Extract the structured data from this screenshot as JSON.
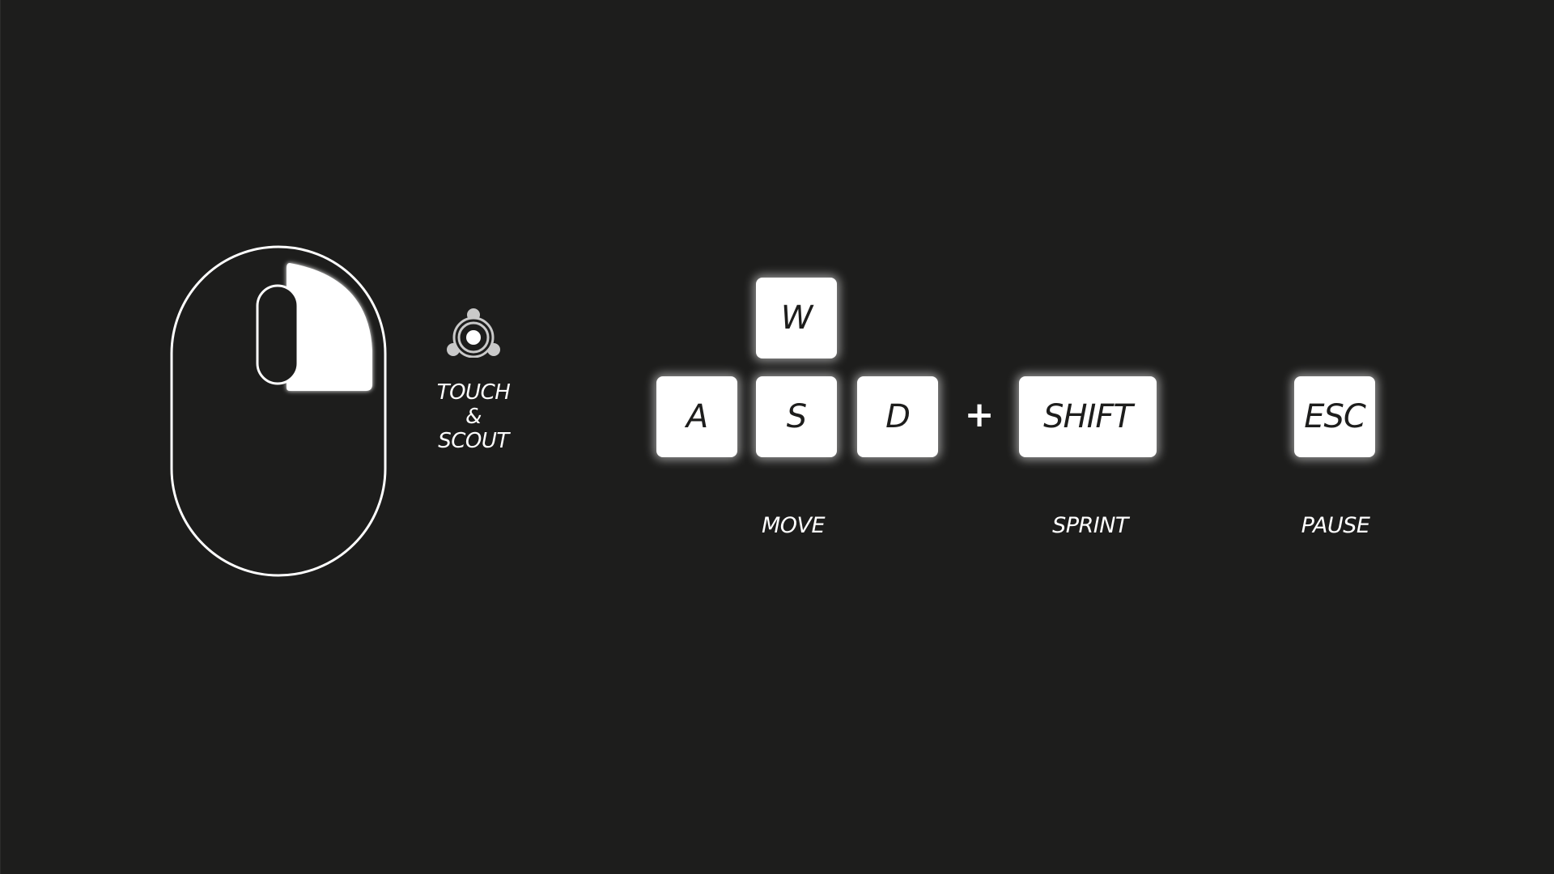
{
  "mouse": {
    "icon": "mouse-icon",
    "highlighted_button": "right"
  },
  "scout": {
    "icon": "scout-icon",
    "label_lines": [
      "TOUCH",
      "&",
      "SCOUT"
    ]
  },
  "keys": {
    "w": "W",
    "a": "A",
    "s": "S",
    "d": "D",
    "plus": "+",
    "shift": "SHIFT",
    "esc": "ESC"
  },
  "labels": {
    "move": "MOVE",
    "sprint": "SPRINT",
    "pause": "PAUSE"
  },
  "colors": {
    "background": "#1d1d1c",
    "key_face": "#ffffff",
    "key_text": "#1d1d1c",
    "foreground": "#ffffff"
  }
}
